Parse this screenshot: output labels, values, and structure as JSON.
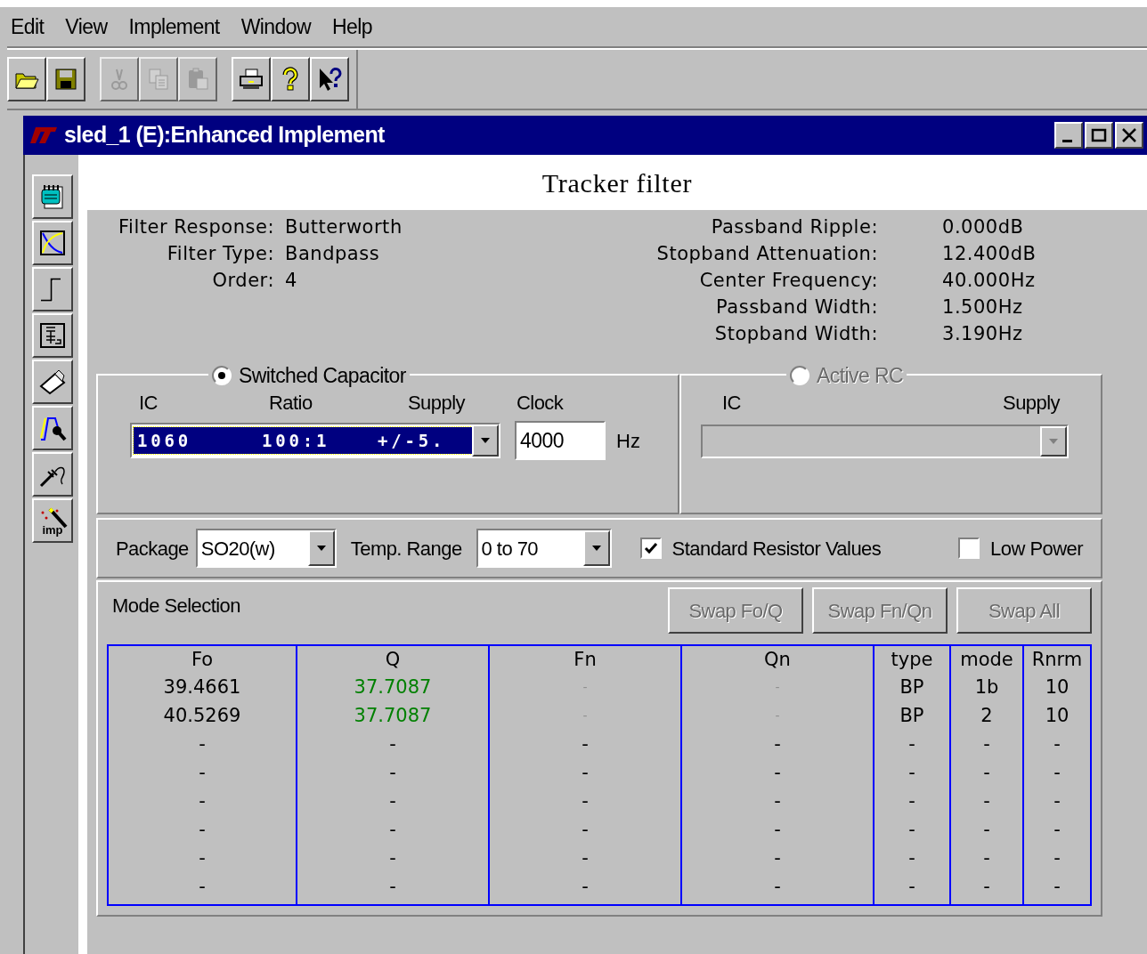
{
  "menu": [
    {
      "label": "Edit"
    },
    {
      "label": "View"
    },
    {
      "label": "Implement"
    },
    {
      "label": "Window"
    },
    {
      "label": "Help"
    }
  ],
  "toolbar": [
    [
      {
        "kind": "open",
        "disabled": false
      },
      {
        "kind": "save",
        "disabled": false
      }
    ],
    [
      {
        "kind": "cut",
        "disabled": true
      },
      {
        "kind": "copy",
        "disabled": true
      },
      {
        "kind": "paste",
        "disabled": true
      }
    ],
    [
      {
        "kind": "print",
        "disabled": false
      },
      {
        "kind": "help",
        "disabled": false
      },
      {
        "kind": "context-help",
        "disabled": false
      }
    ]
  ],
  "window": {
    "title": "sled_1 (E):Enhanced Implement"
  },
  "sidebar": [
    {
      "kind": "notes"
    },
    {
      "kind": "response"
    },
    {
      "kind": "step"
    },
    {
      "kind": "schematic"
    },
    {
      "kind": "paper"
    },
    {
      "kind": "tune"
    },
    {
      "kind": "probe"
    },
    {
      "kind": "implement",
      "label": "imp"
    }
  ],
  "panel_title": "Tracker filter",
  "specs_left": [
    {
      "label": "Filter Response:",
      "value": "Butterworth"
    },
    {
      "label": "Filter Type:",
      "value": "Bandpass"
    },
    {
      "label": "Order:",
      "value": "4"
    }
  ],
  "specs_right": [
    {
      "label": "Passband Ripple:",
      "value": "0.000dB"
    },
    {
      "label": "Stopband Attenuation:",
      "value": "12.400dB"
    },
    {
      "label": "Center Frequency:",
      "value": "40.000Hz"
    },
    {
      "label": "Passband Width:",
      "value": "1.500Hz"
    },
    {
      "label": "Stopband Width:",
      "value": "3.190Hz"
    }
  ],
  "switched_capacitor": {
    "label": "Switched Capacitor",
    "selected": true,
    "disabled": false,
    "columns": [
      "IC",
      "Ratio",
      "Supply",
      "Clock"
    ],
    "part": {
      "ic": "1060",
      "ratio": "100:1",
      "supply": "+/-5."
    },
    "clock": "4000",
    "unit": "Hz"
  },
  "active_rc": {
    "label": "Active RC",
    "selected": false,
    "disabled": true,
    "columns": [
      "IC",
      "Supply"
    ]
  },
  "options": {
    "package_label": "Package",
    "package": "SO20(w)",
    "temp_label": "Temp. Range",
    "temp": "0 to 70",
    "checkboxes": [
      {
        "label": "Standard Resistor Values",
        "checked": true
      },
      {
        "label": "Low Power",
        "checked": false
      }
    ]
  },
  "mode_selection": {
    "title": "Mode Selection",
    "buttons": [
      {
        "label": "Swap Fo/Q",
        "disabled": true
      },
      {
        "label": "Swap Fn/Qn",
        "disabled": true
      },
      {
        "label": "Swap All",
        "disabled": true
      }
    ],
    "columns": [
      "Fo",
      "Q",
      "Fn",
      "Qn",
      "type",
      "mode",
      "Rnrm"
    ],
    "rows": [
      [
        "39.4661",
        {
          "text": "37.7087",
          "kind": "highlight"
        },
        {
          "text": "-",
          "kind": "unused"
        },
        {
          "text": "-",
          "kind": "unused"
        },
        "BP",
        "1b",
        "10"
      ],
      [
        "40.5269",
        {
          "text": "37.7087",
          "kind": "highlight"
        },
        {
          "text": "-",
          "kind": "unused"
        },
        {
          "text": "-",
          "kind": "unused"
        },
        "BP",
        "2",
        "10"
      ],
      [
        "-",
        "-",
        "-",
        "-",
        "-",
        "-",
        "-"
      ],
      [
        "-",
        "-",
        "-",
        "-",
        "-",
        "-",
        "-"
      ],
      [
        "-",
        "-",
        "-",
        "-",
        "-",
        "-",
        "-"
      ],
      [
        "-",
        "-",
        "-",
        "-",
        "-",
        "-",
        "-"
      ],
      [
        "-",
        "-",
        "-",
        "-",
        "-",
        "-",
        "-"
      ],
      [
        "-",
        "-",
        "-",
        "-",
        "-",
        "-",
        "-"
      ]
    ]
  }
}
